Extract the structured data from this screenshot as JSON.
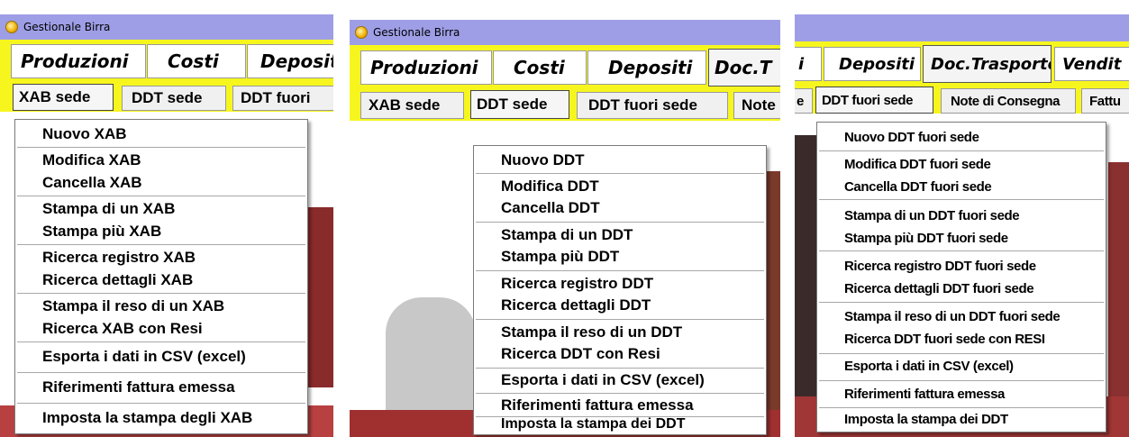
{
  "panels": [
    {
      "window_title": "Gestionale Birra",
      "main_tabs": [
        "Produzioni",
        "Costi",
        "Depositi"
      ],
      "sub_tabs": [
        "XAB sede",
        "DDT sede",
        "DDT fuori"
      ],
      "menu": [
        "Nuovo XAB",
        "Modifica XAB",
        "Cancella XAB",
        "Stampa di un XAB",
        "Stampa più XAB",
        "Ricerca registro XAB",
        "Ricerca dettagli XAB",
        "Stampa il reso di un XAB",
        "Ricerca XAB con Resi",
        "Esporta i dati in CSV (excel)",
        "Riferimenti fattura emessa",
        "Imposta la stampa degli XAB"
      ]
    },
    {
      "window_title": "Gestionale Birra",
      "main_tabs": [
        "Produzioni",
        "Costi",
        "Depositi",
        "Doc.T"
      ],
      "sub_tabs": [
        "XAB sede",
        "DDT sede",
        "DDT fuori sede",
        "Note"
      ],
      "menu": [
        "Nuovo DDT",
        "Modifica DDT",
        "Cancella DDT",
        "Stampa di un DDT",
        "Stampa più DDT",
        "Ricerca registro DDT",
        "Ricerca dettagli DDT",
        "Stampa il reso di un DDT",
        "Ricerca DDT con Resi",
        "Esporta i dati in CSV (excel)",
        "Riferimenti fattura emessa",
        "Imposta la stampa dei DDT"
      ]
    },
    {
      "main_tabs": [
        "i",
        "Depositi",
        "Doc.Trasporto",
        "Vendit"
      ],
      "sub_tabs": [
        "e",
        "DDT fuori sede",
        "Note di Consegna",
        "Fattu"
      ],
      "menu": [
        "Nuovo DDT fuori sede",
        "Modifica DDT fuori sede",
        "Cancella DDT fuori sede",
        "Stampa di un DDT fuori sede",
        "Stampa più DDT fuori sede",
        "Ricerca registro DDT fuori sede",
        "Ricerca dettagli DDT fuori sede",
        "Stampa il reso di un DDT fuori sede",
        "Ricerca DDT fuori sede con RESI",
        "Esporta i dati in CSV (excel)",
        "Riferimenti fattura emessa",
        "Imposta la stampa dei DDT"
      ]
    }
  ],
  "colors": {
    "titlebar": "#9e9ee6",
    "tabstrip": "#f6f61e",
    "menu_bg": "#ffffff"
  },
  "icons": {
    "app": "app-icon"
  }
}
